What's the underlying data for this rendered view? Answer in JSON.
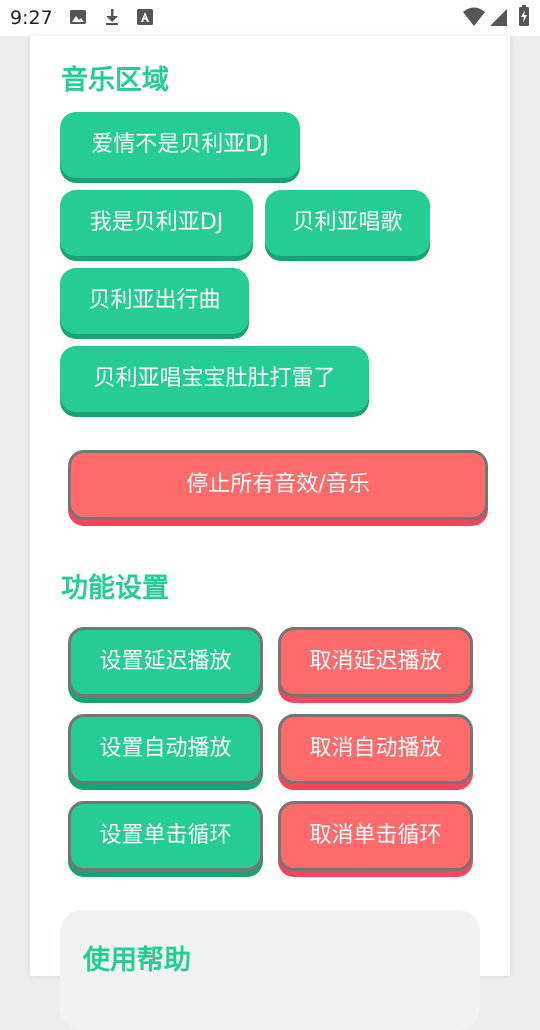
{
  "status_bar": {
    "time": "9:27",
    "icons": [
      "image-icon",
      "download-icon",
      "font-a-icon",
      "wifi-icon",
      "signal-icon",
      "battery-icon"
    ]
  },
  "music": {
    "title": "音乐区域",
    "items": [
      {
        "label": "爱情不是贝利亚DJ"
      },
      {
        "label": "我是贝利亚DJ"
      },
      {
        "label": "贝利亚唱歌"
      },
      {
        "label": "贝利亚出行曲"
      },
      {
        "label": "贝利亚唱宝宝肚肚打雷了"
      }
    ],
    "stop_label": "停止所有音效/音乐"
  },
  "settings": {
    "title": "功能设置",
    "set_delay": "设置延迟播放",
    "cancel_delay": "取消延迟播放",
    "set_auto": "设置自动播放",
    "cancel_auto": "取消自动播放",
    "set_loop": "设置单击循环",
    "cancel_loop": "取消单击循环"
  },
  "help": {
    "title": "使用帮助"
  },
  "colors": {
    "accent_green": "#25cd95",
    "accent_red": "#ff6b6b"
  }
}
